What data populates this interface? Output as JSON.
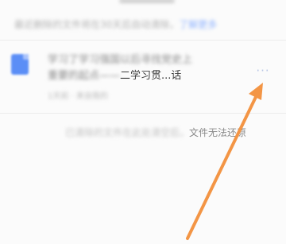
{
  "notice": {
    "text_prefix": "最近删除的文件将在30天后自动清除，",
    "link": "了解更多"
  },
  "file": {
    "icon": "doc-file-icon",
    "title_line1": "学习了学习强国以后寻找党史上",
    "title_line2_prefix": "重要的起点——",
    "title_line2_clear": "二学习贯...话",
    "meta": "1天前  ·  来自我的",
    "more_label": "···"
  },
  "footer": {
    "prefix": "已清除的文件在此处清空后，",
    "suffix": "文件无法还原"
  },
  "colors": {
    "accent_blue": "#5b8ef6",
    "arrow_orange": "#f39545"
  }
}
